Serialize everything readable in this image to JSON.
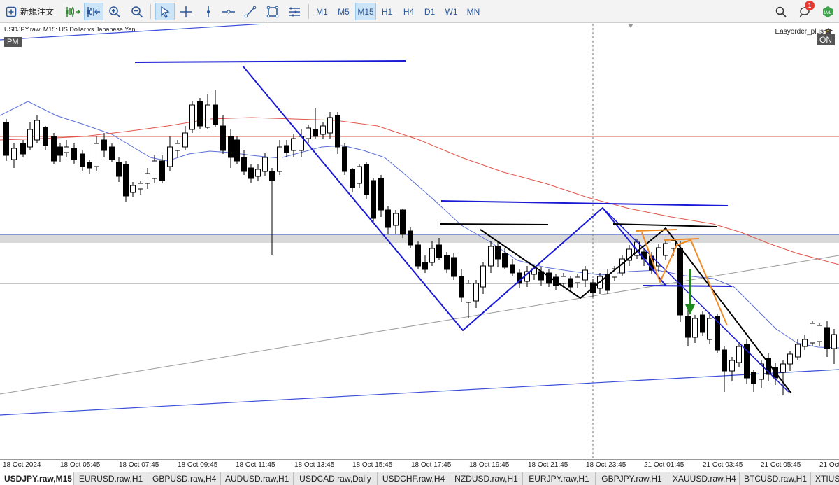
{
  "toolbar": {
    "new_order_label": "新規注文",
    "icons": [
      "new-order-icon",
      "one-click-trading-icon",
      "depth-of-market-icon",
      "zoom-in-icon",
      "zoom-out-icon",
      "cursor-icon",
      "crosshair-icon",
      "vertical-line-icon",
      "horizontal-line-icon",
      "trendline-icon",
      "shapes-icon",
      "indicators-icon"
    ],
    "timeframes": [
      "M1",
      "M5",
      "M15",
      "H1",
      "H4",
      "D1",
      "W1",
      "MN"
    ],
    "active_timeframe": "M15",
    "notification_count": "1"
  },
  "chart": {
    "symbol_description": "USDJPY.raw, M15:  US Dollar vs Japanese Yen",
    "session_badge": "PM",
    "ea_name": "Easyorder_plus",
    "ea_status": "ON",
    "time_labels": [
      "18 Oct 2024",
      "18 Oct 05:45",
      "18 Oct 07:45",
      "18 Oct 09:45",
      "18 Oct 11:45",
      "18 Oct 13:45",
      "18 Oct 15:45",
      "18 Oct 17:45",
      "18 Oct 19:45",
      "18 Oct 21:45",
      "18 Oct 23:45",
      "21 Oct 01:45",
      "21 Oct 03:45",
      "21 Oct 05:45",
      "21 Oct"
    ]
  },
  "tabs": [
    "USDJPY.raw,M15",
    "EURUSD.raw,H1",
    "GBPUSD.raw,H4",
    "AUDUSD.raw,H1",
    "USDCAD.raw,Daily",
    "USDCHF.raw,H4",
    "NZDUSD.raw,H1",
    "EURJPY.raw,H1",
    "GBPJPY.raw,H1",
    "XAUUSD.raw,H4",
    "BTCUSD.raw,H1",
    "XTIUS"
  ],
  "active_tab": "USDJPY.raw,M15",
  "colors": {
    "bull_candle": "#ffffff",
    "bear_candle": "#000000",
    "ma_fast": "#5b6fd6",
    "ma_slow": "#e0554a",
    "pattern_line": "#1a1ad6",
    "highlight_line": "#f08a24",
    "signal_arrow": "#1e8a1e"
  }
}
